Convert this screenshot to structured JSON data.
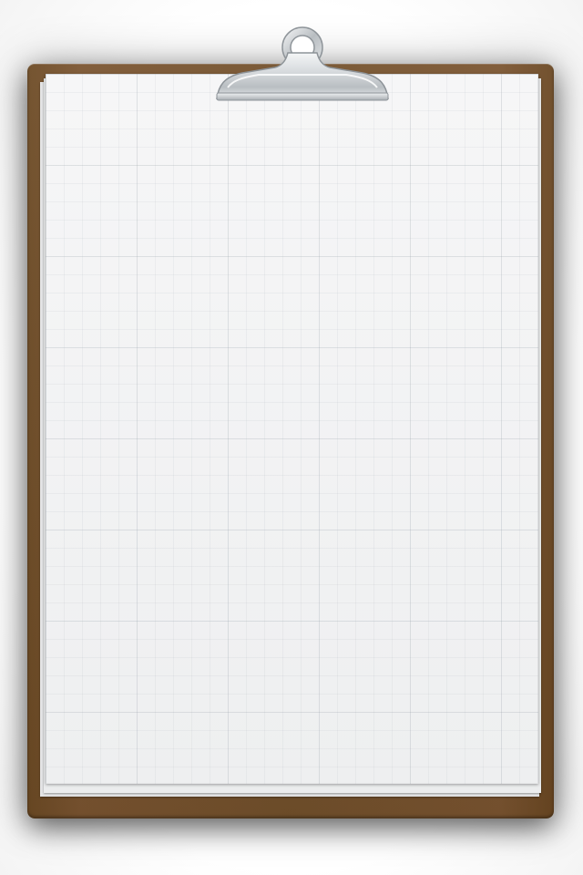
{
  "screen": {
    "name": "empty-clipboard-canvas"
  },
  "colors": {
    "board": "#72502b",
    "paper": "#f1f2f3",
    "grid": "#96a0aa",
    "clip_metal": "#c9cdd1",
    "background": "#ffffff"
  },
  "icons": {
    "clip": "metal-clip-icon"
  }
}
